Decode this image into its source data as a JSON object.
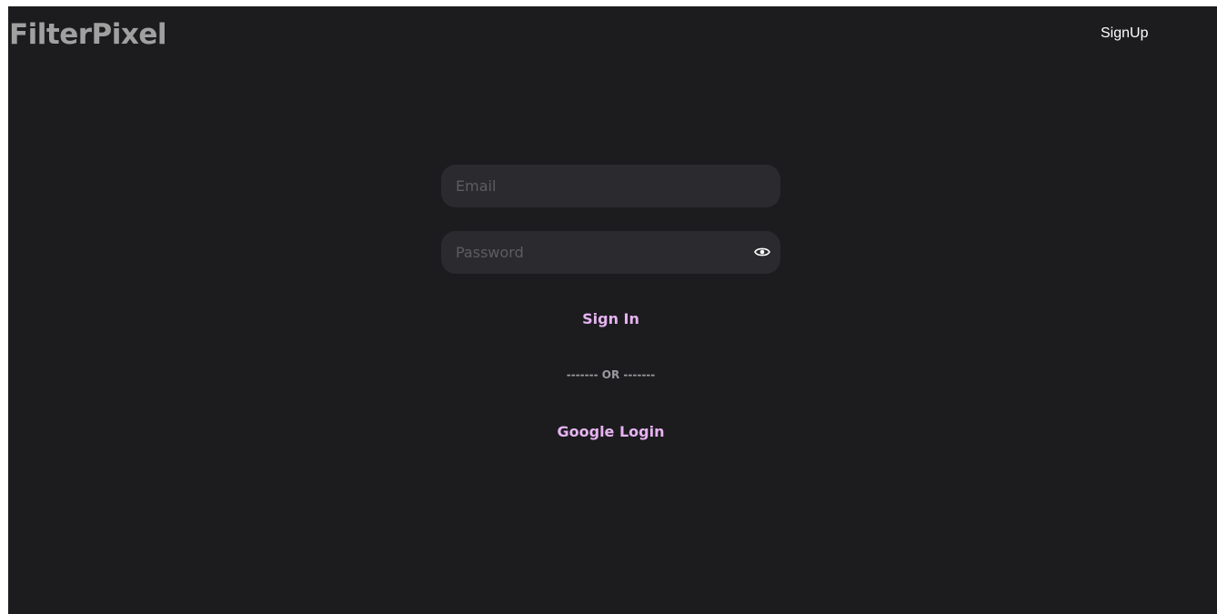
{
  "header": {
    "brand": "FilterPixel",
    "signup_label": "SignUp"
  },
  "form": {
    "email_placeholder": "Email",
    "email_value": "",
    "password_placeholder": "Password",
    "password_value": "",
    "password_toggle_icon": "eye-icon",
    "signin_label": "Sign In",
    "divider_text": "------- OR -------",
    "google_label": "Google Login"
  },
  "colors": {
    "background": "#1c1c1f",
    "input_background": "#2b2b2f",
    "brand_text": "#a0a0a0",
    "accent": "#e6b3f0",
    "divider_text": "#9a9a9e"
  }
}
